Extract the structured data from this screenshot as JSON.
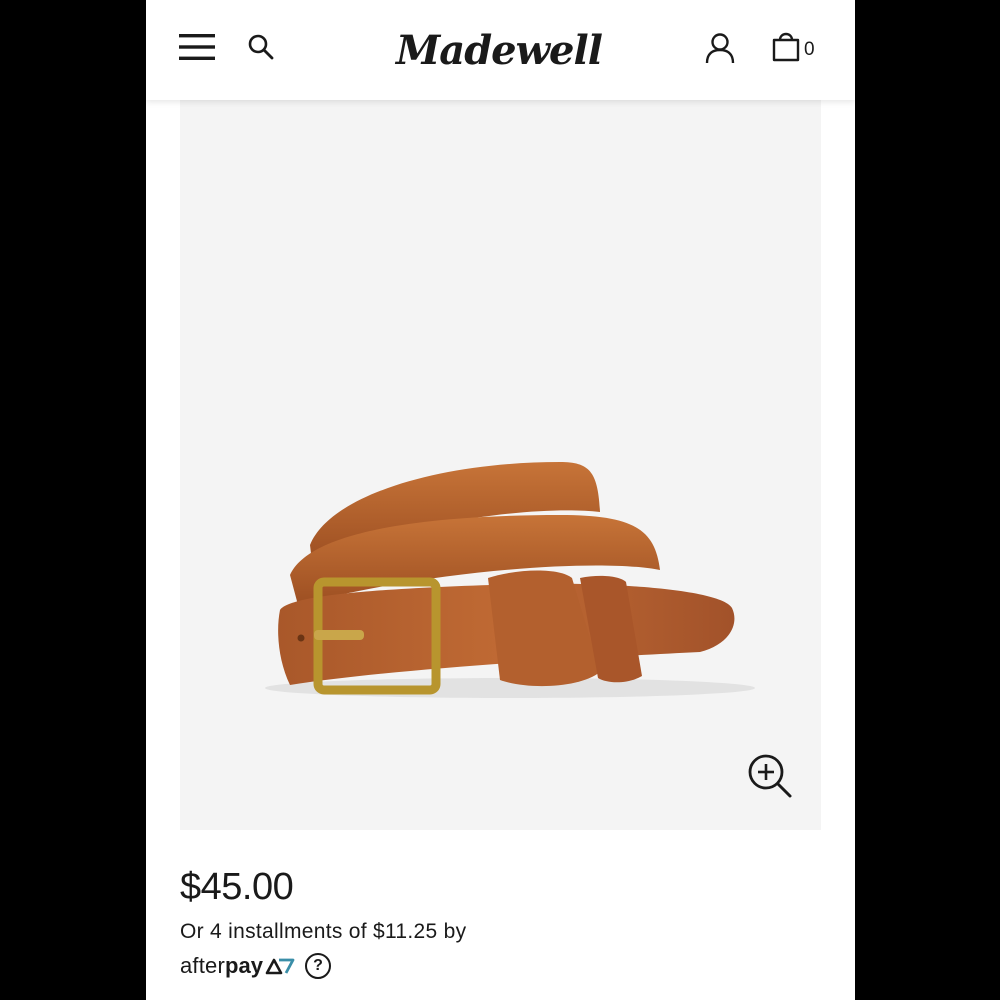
{
  "header": {
    "brand": "Madewell",
    "cart_count": "0",
    "icons": [
      "hamburger-menu-icon",
      "search-icon",
      "account-icon",
      "shopping-bag-icon"
    ]
  },
  "product": {
    "image_alt": "Leather belt with brass buckle",
    "zoom_icon": "zoom-in-icon",
    "price": "$45.00",
    "installments_text": "Or 4 installments of $11.25 by",
    "afterpay": {
      "light": "after",
      "bold": "pay",
      "help_symbol": "?"
    }
  },
  "colors": {
    "text": "#1a1a1a",
    "image_bg": "#f4f4f4",
    "leather": "#b5622e",
    "brass": "#b8952e",
    "afterpay_teal": "#3a8ea8"
  }
}
